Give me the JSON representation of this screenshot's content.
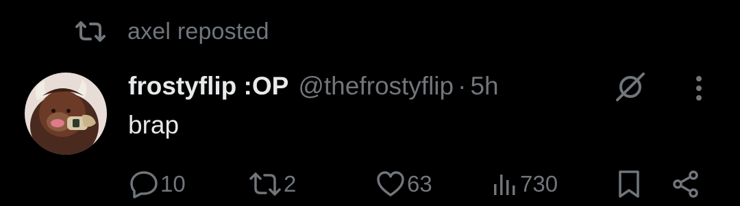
{
  "repost_banner": {
    "text": "axel reposted"
  },
  "post": {
    "display_name": "frostyflip :OP",
    "handle": "@thefrostyflip",
    "separator": "·",
    "time": "5h",
    "text": "brap"
  },
  "actions": {
    "replies": "10",
    "reposts": "2",
    "likes": "63",
    "views": "730"
  },
  "colors": {
    "background": "#000000",
    "primary_text": "#e7e9ea",
    "secondary_text": "#71767b"
  },
  "icons": [
    "repost-icon",
    "grok-icon",
    "more-options-icon",
    "reply-icon",
    "like-icon",
    "views-icon",
    "bookmark-icon",
    "share-icon"
  ]
}
